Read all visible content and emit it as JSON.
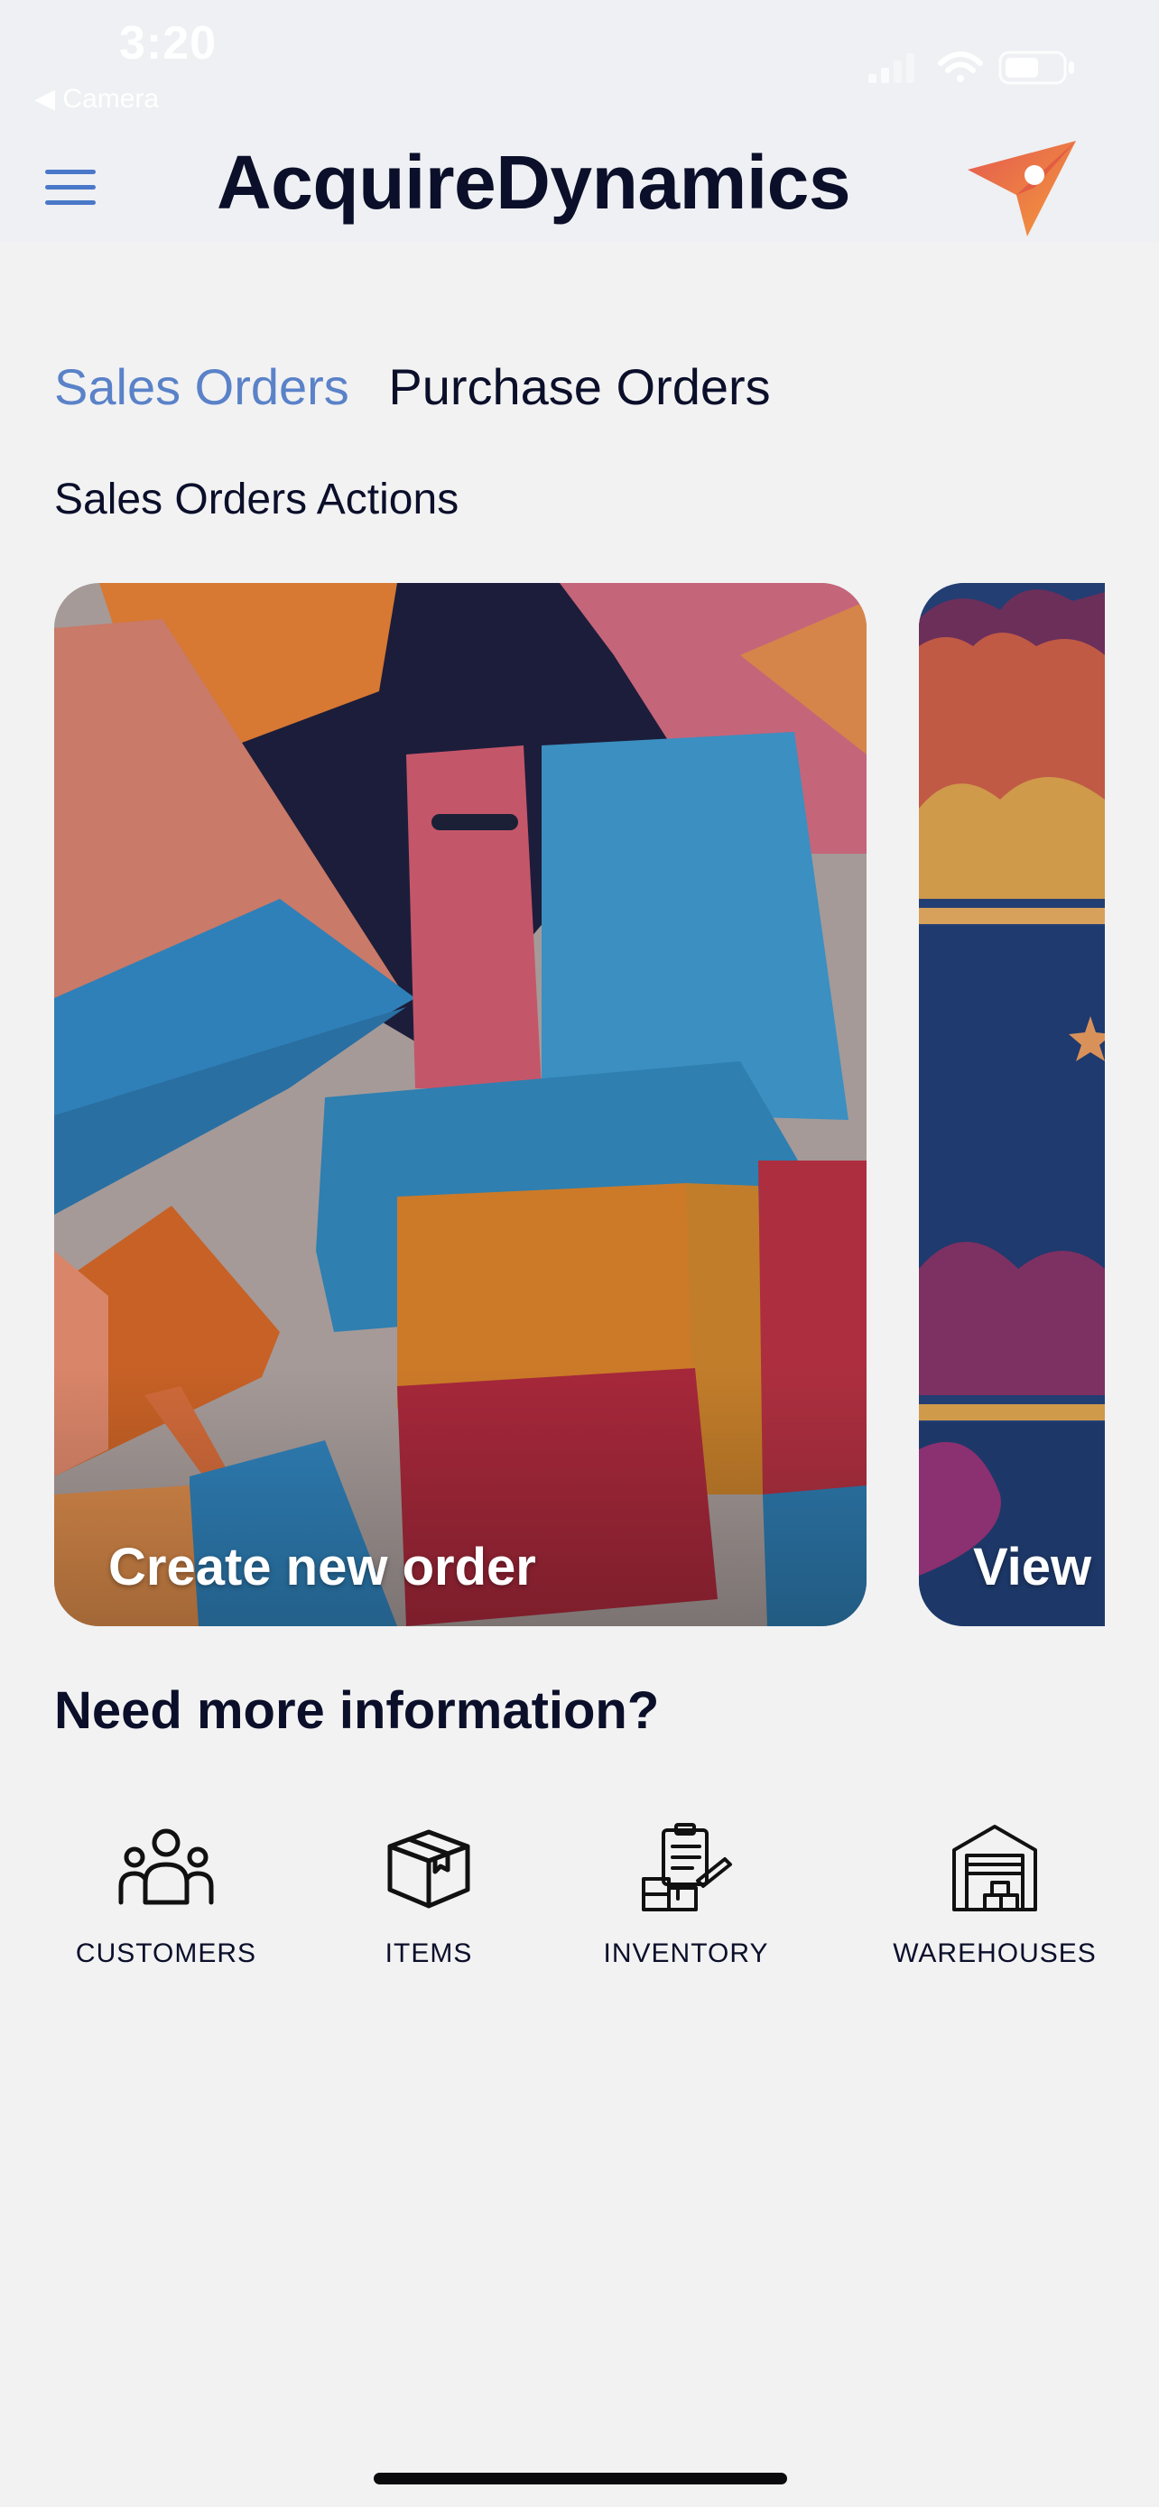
{
  "status_bar": {
    "time": "3:20",
    "back_label": "◀ Camera"
  },
  "header": {
    "title": "AcquireDynamics",
    "menu_icon": "hamburger-menu-icon",
    "logo_icon": "paper-plane-logo-icon"
  },
  "tabs": [
    {
      "label": "Sales Orders",
      "active": true
    },
    {
      "label": "Purchase Orders",
      "active": false
    }
  ],
  "section_label": "Sales Orders Actions",
  "cards": [
    {
      "caption": "Create new order",
      "image": "colorful-notebooks-illustration"
    },
    {
      "caption": "View",
      "image": "night-sky-clouds-illustration"
    }
  ],
  "info": {
    "heading": "Need more information?",
    "items": [
      {
        "label": "CUSTOMERS",
        "icon": "people-group-icon"
      },
      {
        "label": "ITEMS",
        "icon": "box-package-icon"
      },
      {
        "label": "INVENTORY",
        "icon": "clipboard-boxes-icon"
      },
      {
        "label": "WAREHOUSES",
        "icon": "warehouse-icon"
      }
    ]
  },
  "colors": {
    "accent": "#5a82c8",
    "text": "#0b0f2a",
    "background": "#f2f2f3"
  }
}
